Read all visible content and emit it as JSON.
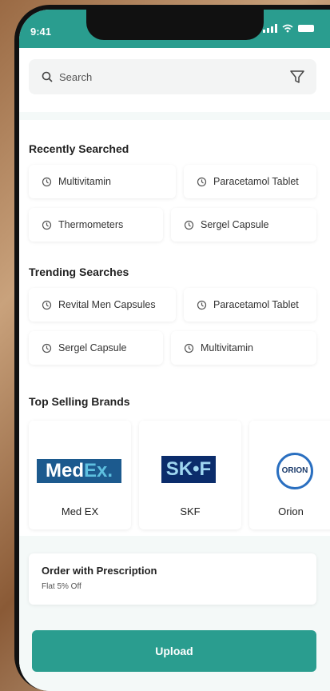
{
  "status_bar": {
    "time": "9:41"
  },
  "search": {
    "placeholder": "Search"
  },
  "recently_searched": {
    "title": "Recently Searched",
    "items": [
      "Multivitamin",
      "Paracetamol Tablet",
      "Thermometers",
      "Sergel Capsule"
    ]
  },
  "trending": {
    "title": "Trending Searches",
    "items": [
      "Revital Men Capsules",
      "Paracetamol Tablet",
      "Sergel Capsule",
      "Multivitamin"
    ]
  },
  "brands": {
    "title": "Top Selling Brands",
    "items": [
      {
        "name": "Med EX",
        "logo_main": "Med",
        "logo_accent": "Ex."
      },
      {
        "name": "SKF",
        "logo_main": "SK•F"
      },
      {
        "name": "Orion",
        "logo_main": "ORION"
      }
    ]
  },
  "prescription": {
    "title": "Order with Prescription",
    "subtitle": "Flat 5% Off"
  },
  "upload_button": {
    "label": "Upload"
  },
  "colors": {
    "accent": "#2a9d8f",
    "text": "#222222"
  }
}
